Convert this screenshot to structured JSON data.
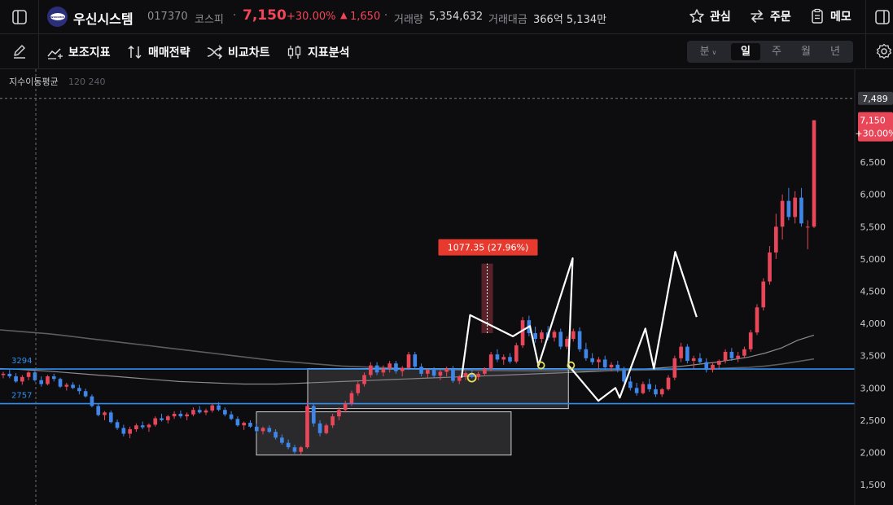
{
  "header": {
    "logo_text": "WOOSHIN",
    "company_name": "우신시스템",
    "code": "017370",
    "market": "코스피",
    "price": "7,150",
    "change_pct": "+30.00%",
    "change_abs": "1,650",
    "volume_label": "거래량",
    "volume_value": "5,354,632",
    "trade_amount_label": "거래대금",
    "trade_amount_value": "366억 5,134만",
    "watch_label": "관심",
    "order_label": "주문",
    "memo_label": "메모"
  },
  "toolbar": {
    "indicators_label": "보조지표",
    "strategy_label": "매매전략",
    "compare_label": "비교차트",
    "analysis_label": "지표분석",
    "periods": [
      "분",
      "일",
      "주",
      "월",
      "년"
    ],
    "active_period": "일"
  },
  "chart_overlay": {
    "ma_label": "지수이동평균",
    "ma_params": "120 240",
    "measure_label": "1077.35 (27.96%)",
    "line_a_label": "3294",
    "line_b_label": "2757",
    "crosshair_price": "7,489",
    "last_price": "7,150",
    "last_change": "+30.00%"
  },
  "colors": {
    "up": "#e8475a",
    "down": "#3f86e8",
    "hline": "#2f8ff0",
    "price_badge": "#e8475a"
  },
  "chart_data": {
    "type": "candlestick",
    "y_ticks": [
      1500,
      2000,
      2500,
      3000,
      3500,
      4000,
      4500,
      5000,
      5500,
      6000,
      6500
    ],
    "y_tick_labels": [
      "1,500",
      "2,000",
      "2,500",
      "3,000",
      "3,500",
      "4,000",
      "4,500",
      "5,000",
      "5,500",
      "6,000",
      "6,500"
    ],
    "ylim": [
      1300,
      7800
    ],
    "horizontal_lines": [
      3294,
      2757
    ],
    "measure": {
      "from": 3850,
      "to": 4927,
      "value": 1077.35,
      "pct": 27.96
    },
    "ohlc": [
      [
        3200,
        3250,
        3150,
        3220
      ],
      [
        3220,
        3280,
        3150,
        3180
      ],
      [
        3180,
        3230,
        3080,
        3100
      ],
      [
        3100,
        3200,
        3050,
        3170
      ],
      [
        3170,
        3260,
        3120,
        3240
      ],
      [
        3240,
        3290,
        3100,
        3120
      ],
      [
        3120,
        3180,
        3020,
        3060
      ],
      [
        3060,
        3200,
        3040,
        3180
      ],
      [
        3180,
        3220,
        3100,
        3140
      ],
      [
        3140,
        3160,
        3000,
        3020
      ],
      [
        3020,
        3080,
        2960,
        3050
      ],
      [
        3050,
        3090,
        2980,
        3000
      ],
      [
        3000,
        3050,
        2900,
        2950
      ],
      [
        2950,
        2990,
        2850,
        2870
      ],
      [
        2870,
        2900,
        2700,
        2720
      ],
      [
        2720,
        2760,
        2560,
        2580
      ],
      [
        2580,
        2640,
        2500,
        2620
      ],
      [
        2620,
        2650,
        2450,
        2470
      ],
      [
        2470,
        2510,
        2350,
        2380
      ],
      [
        2380,
        2430,
        2250,
        2290
      ],
      [
        2290,
        2400,
        2220,
        2360
      ],
      [
        2360,
        2450,
        2320,
        2420
      ],
      [
        2420,
        2480,
        2360,
        2390
      ],
      [
        2390,
        2450,
        2320,
        2430
      ],
      [
        2430,
        2560,
        2400,
        2530
      ],
      [
        2530,
        2600,
        2480,
        2500
      ],
      [
        2500,
        2580,
        2450,
        2560
      ],
      [
        2560,
        2640,
        2520,
        2600
      ],
      [
        2600,
        2650,
        2530,
        2560
      ],
      [
        2560,
        2620,
        2500,
        2590
      ],
      [
        2590,
        2700,
        2560,
        2660
      ],
      [
        2660,
        2720,
        2600,
        2620
      ],
      [
        2620,
        2680,
        2580,
        2650
      ],
      [
        2650,
        2760,
        2620,
        2730
      ],
      [
        2730,
        2780,
        2640,
        2660
      ],
      [
        2660,
        2700,
        2560,
        2590
      ],
      [
        2590,
        2640,
        2500,
        2520
      ],
      [
        2520,
        2560,
        2400,
        2420
      ],
      [
        2420,
        2480,
        2350,
        2460
      ],
      [
        2460,
        2500,
        2380,
        2400
      ],
      [
        2400,
        2450,
        2300,
        2330
      ],
      [
        2330,
        2400,
        2280,
        2380
      ],
      [
        2380,
        2420,
        2300,
        2320
      ],
      [
        2320,
        2360,
        2200,
        2230
      ],
      [
        2230,
        2280,
        2120,
        2150
      ],
      [
        2150,
        2200,
        2050,
        2080
      ],
      [
        2080,
        2120,
        1980,
        2010
      ],
      [
        2010,
        2100,
        1960,
        2080
      ],
      [
        2080,
        2800,
        2060,
        2720
      ],
      [
        2720,
        2760,
        2400,
        2450
      ],
      [
        2450,
        2500,
        2250,
        2300
      ],
      [
        2300,
        2450,
        2280,
        2420
      ],
      [
        2420,
        2600,
        2380,
        2560
      ],
      [
        2560,
        2700,
        2500,
        2660
      ],
      [
        2660,
        2800,
        2620,
        2760
      ],
      [
        2760,
        2960,
        2720,
        2920
      ],
      [
        2920,
        3100,
        2880,
        3060
      ],
      [
        3060,
        3240,
        3020,
        3200
      ],
      [
        3200,
        3400,
        3160,
        3350
      ],
      [
        3350,
        3400,
        3200,
        3240
      ],
      [
        3240,
        3350,
        3180,
        3300
      ],
      [
        3300,
        3420,
        3240,
        3380
      ],
      [
        3380,
        3420,
        3220,
        3260
      ],
      [
        3260,
        3340,
        3180,
        3310
      ],
      [
        3310,
        3560,
        3280,
        3520
      ],
      [
        3520,
        3560,
        3300,
        3330
      ],
      [
        3330,
        3380,
        3180,
        3220
      ],
      [
        3220,
        3300,
        3150,
        3280
      ],
      [
        3280,
        3320,
        3160,
        3190
      ],
      [
        3190,
        3280,
        3120,
        3250
      ],
      [
        3250,
        3330,
        3180,
        3300
      ],
      [
        3300,
        3340,
        3080,
        3110
      ],
      [
        3110,
        3200,
        3060,
        3180
      ],
      [
        3180,
        3260,
        3120,
        3230
      ],
      [
        3230,
        3300,
        3150,
        3170
      ],
      [
        3170,
        3250,
        3120,
        3220
      ],
      [
        3220,
        3320,
        3180,
        3300
      ],
      [
        3300,
        3560,
        3260,
        3520
      ],
      [
        3520,
        3600,
        3400,
        3440
      ],
      [
        3440,
        3520,
        3360,
        3480
      ],
      [
        3480,
        3540,
        3380,
        3410
      ],
      [
        3410,
        3700,
        3380,
        3660
      ],
      [
        3660,
        4100,
        3620,
        4050
      ],
      [
        4050,
        4120,
        3800,
        3850
      ],
      [
        3850,
        3950,
        3700,
        3760
      ],
      [
        3760,
        3900,
        3700,
        3860
      ],
      [
        3860,
        3960,
        3740,
        3780
      ],
      [
        3780,
        3900,
        3720,
        3870
      ],
      [
        3870,
        3920,
        3600,
        3640
      ],
      [
        3640,
        3800,
        3600,
        3760
      ],
      [
        3760,
        3920,
        3720,
        3880
      ],
      [
        3880,
        3940,
        3560,
        3600
      ],
      [
        3600,
        3700,
        3420,
        3460
      ],
      [
        3460,
        3540,
        3360,
        3400
      ],
      [
        3400,
        3480,
        3300,
        3440
      ],
      [
        3440,
        3500,
        3280,
        3320
      ],
      [
        3320,
        3400,
        3260,
        3360
      ],
      [
        3360,
        3420,
        3240,
        3280
      ],
      [
        3280,
        3330,
        3080,
        3100
      ],
      [
        3100,
        3180,
        2960,
        3000
      ],
      [
        3000,
        3080,
        2880,
        2920
      ],
      [
        2920,
        3100,
        2900,
        3060
      ],
      [
        3060,
        3140,
        2940,
        2980
      ],
      [
        2980,
        3050,
        2860,
        2900
      ],
      [
        2900,
        3000,
        2860,
        2980
      ],
      [
        2980,
        3200,
        2960,
        3160
      ],
      [
        3160,
        3500,
        3120,
        3460
      ],
      [
        3460,
        3700,
        3400,
        3640
      ],
      [
        3640,
        3680,
        3380,
        3420
      ],
      [
        3420,
        3500,
        3300,
        3460
      ],
      [
        3460,
        3540,
        3380,
        3400
      ],
      [
        3400,
        3460,
        3240,
        3280
      ],
      [
        3280,
        3400,
        3240,
        3360
      ],
      [
        3360,
        3440,
        3300,
        3420
      ],
      [
        3420,
        3600,
        3380,
        3560
      ],
      [
        3560,
        3620,
        3420,
        3460
      ],
      [
        3460,
        3560,
        3400,
        3500
      ],
      [
        3500,
        3640,
        3460,
        3600
      ],
      [
        3600,
        3900,
        3560,
        3860
      ],
      [
        3860,
        4300,
        3820,
        4250
      ],
      [
        4250,
        4700,
        4200,
        4650
      ],
      [
        4650,
        5200,
        4600,
        5100
      ],
      [
        5100,
        5700,
        5000,
        5500
      ],
      [
        5500,
        6000,
        5300,
        5900
      ],
      [
        5900,
        6100,
        5600,
        5650
      ],
      [
        5650,
        6050,
        5550,
        5950
      ],
      [
        5950,
        6100,
        5500,
        5550
      ],
      [
        5500,
        5600,
        5150,
        5500
      ],
      [
        5500,
        7150,
        5480,
        7150
      ]
    ],
    "ma120": [
      3300,
      3290,
      3275,
      3260,
      3240,
      3220,
      3200,
      3180,
      3160,
      3140,
      3120,
      3100,
      3090,
      3080,
      3070,
      3060,
      3060,
      3060,
      3070,
      3080,
      3090,
      3100,
      3110,
      3120,
      3130,
      3140,
      3150,
      3160,
      3170,
      3180,
      3190,
      3200,
      3210,
      3220,
      3230,
      3240,
      3250,
      3260,
      3270,
      3280,
      3300,
      3320,
      3340,
      3370,
      3400,
      3440,
      3480,
      3540,
      3620,
      3740,
      3820
    ],
    "ma240": [
      3900,
      3880,
      3860,
      3840,
      3810,
      3780,
      3750,
      3720,
      3690,
      3660,
      3630,
      3600,
      3570,
      3540,
      3510,
      3480,
      3450,
      3420,
      3400,
      3380,
      3360,
      3340,
      3330,
      3320,
      3310,
      3300,
      3290,
      3285,
      3280,
      3275,
      3270,
      3268,
      3266,
      3265,
      3265,
      3266,
      3268,
      3270,
      3272,
      3275,
      3280,
      3285,
      3290,
      3295,
      3300,
      3310,
      3320,
      3340,
      3370,
      3410,
      3450
    ],
    "pattern_polyline": [
      [
        3160,
        0.54
      ],
      [
        4130,
        0.55
      ],
      [
        3800,
        0.6
      ],
      [
        3960,
        0.62
      ],
      [
        3350,
        0.63
      ],
      [
        5010,
        0.67
      ],
      [
        3350,
        0.665
      ],
      [
        2800,
        0.7
      ],
      [
        3000,
        0.72
      ],
      [
        2850,
        0.725
      ],
      [
        3920,
        0.755
      ],
      [
        3300,
        0.765
      ],
      [
        5110,
        0.79
      ],
      [
        4100,
        0.815
      ]
    ],
    "markers": [
      3160,
      3350,
      3350
    ],
    "boxes": [
      {
        "x0": 0.36,
        "x1": 0.665,
        "top": 3300,
        "bottom": 2680
      },
      {
        "x0": 0.3,
        "x1": 0.598,
        "top": 2630,
        "bottom": 1960
      }
    ]
  }
}
